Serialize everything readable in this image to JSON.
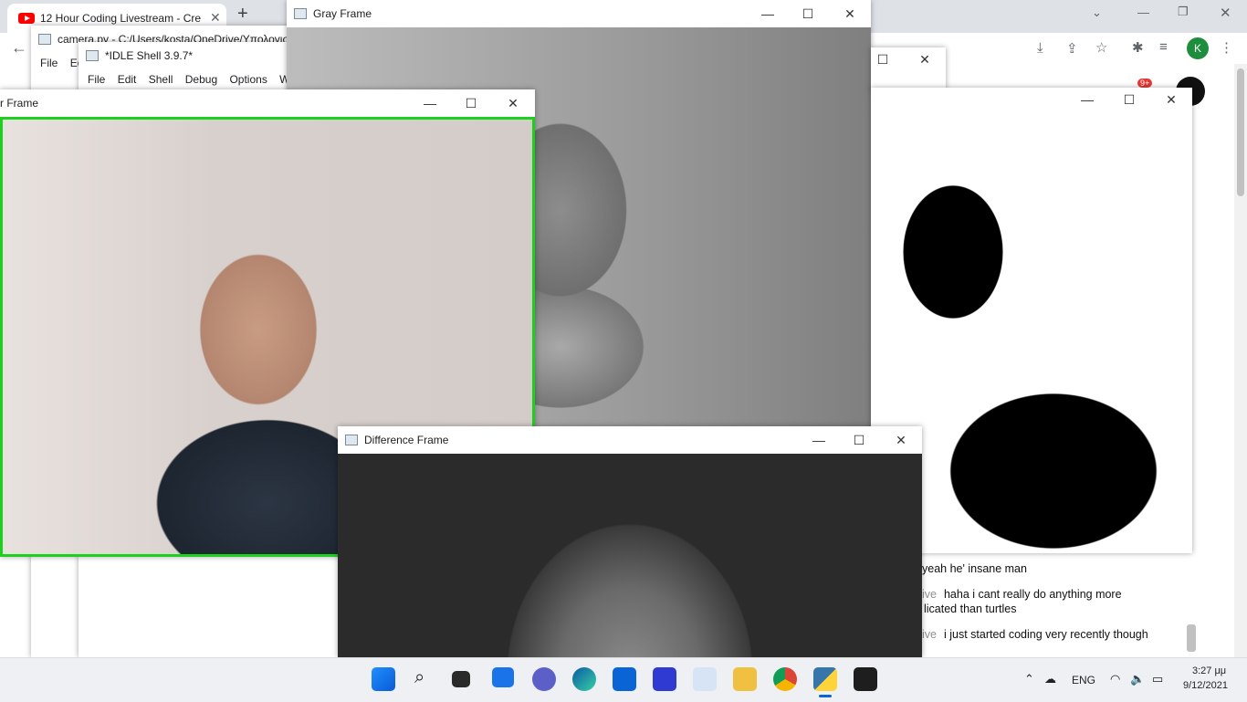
{
  "browser": {
    "tab_title": "12 Hour Coding Livestream - Cre",
    "tab_close": "✕",
    "new_tab": "+",
    "avatar_letter": "K",
    "notification_badge": "9+"
  },
  "editor_window": {
    "title": "camera.py - C:/Users/kosta/OneDrive/Υπολογισ",
    "menu": [
      "File",
      "Ed"
    ]
  },
  "idle_window": {
    "title": "*IDLE Shell 3.9.7*",
    "menu": [
      "File",
      "Edit",
      "Shell",
      "Debug",
      "Options",
      "W"
    ]
  },
  "color_window": {
    "title": "r Frame"
  },
  "gray_window": {
    "title": "Gray Frame"
  },
  "difference_window": {
    "title": "Difference Frame"
  },
  "chat": [
    {
      "author": "",
      "text": "yeah he' insane man"
    },
    {
      "author": "ive",
      "text": "haha i cant really do anything more"
    },
    {
      "author": "",
      "text": "licated than turtles"
    },
    {
      "author": "ive",
      "text": "i just started coding very recently though"
    }
  ],
  "window_buttons": {
    "minimize": "—",
    "maximize": "☐",
    "close": "✕"
  },
  "taskbar": {
    "language": "ENG",
    "time": "3:27 μμ",
    "date": "9/12/2021"
  }
}
